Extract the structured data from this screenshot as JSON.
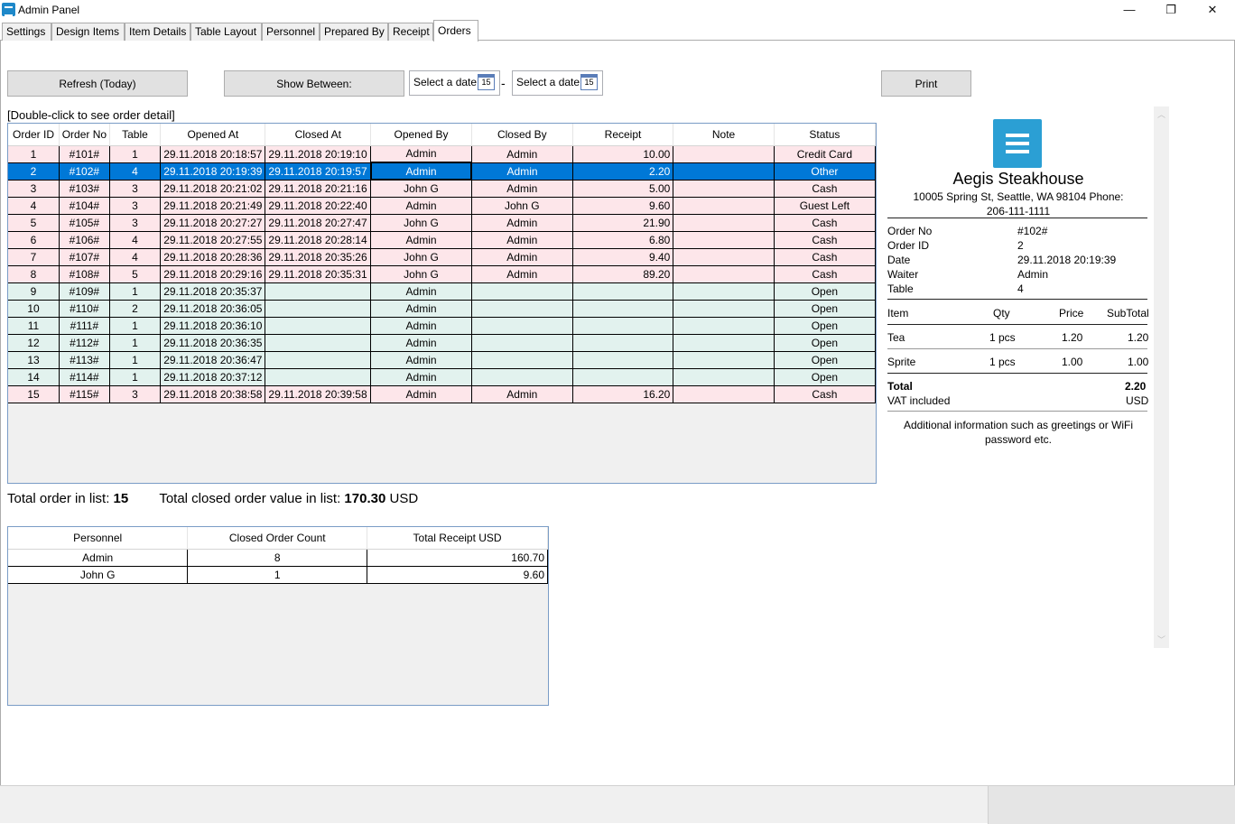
{
  "window": {
    "title": "Admin Panel",
    "minimize": "—",
    "restore": "❐",
    "close": "✕"
  },
  "tabs": [
    "Settings",
    "Design Items",
    "Item Details",
    "Table Layout",
    "Personnel",
    "Prepared By",
    "Receipt",
    "Orders"
  ],
  "active_tab": "Orders",
  "toolbar": {
    "refresh_label": "Refresh (Today)",
    "show_between_label": "Show Between:",
    "date_from_placeholder": "Select a date",
    "date_to_placeholder": "Select a date",
    "calendar_day": "15",
    "dash": "-",
    "print_label": "Print"
  },
  "hint": "[Double-click to see order detail]",
  "orders": {
    "columns": [
      "Order ID",
      "Order No",
      "Table",
      "Opened At",
      "Closed At",
      "Opened By",
      "Closed By",
      "Receipt",
      "Note",
      "Status"
    ],
    "selected_index": 1,
    "rows": [
      {
        "id": "1",
        "no": "#101#",
        "table": "1",
        "opened_at": "29.11.2018 20:18:57",
        "closed_at": "29.11.2018 20:19:10",
        "opened_by": "Admin",
        "closed_by": "Admin",
        "receipt": "10.00",
        "note": "",
        "status": "Credit Card"
      },
      {
        "id": "2",
        "no": "#102#",
        "table": "4",
        "opened_at": "29.11.2018 20:19:39",
        "closed_at": "29.11.2018 20:19:57",
        "opened_by": "Admin",
        "closed_by": "Admin",
        "receipt": "2.20",
        "note": "",
        "status": "Other"
      },
      {
        "id": "3",
        "no": "#103#",
        "table": "3",
        "opened_at": "29.11.2018 20:21:02",
        "closed_at": "29.11.2018 20:21:16",
        "opened_by": "John G",
        "closed_by": "Admin",
        "receipt": "5.00",
        "note": "",
        "status": "Cash"
      },
      {
        "id": "4",
        "no": "#104#",
        "table": "3",
        "opened_at": "29.11.2018 20:21:49",
        "closed_at": "29.11.2018 20:22:40",
        "opened_by": "Admin",
        "closed_by": "John G",
        "receipt": "9.60",
        "note": "",
        "status": "Guest Left"
      },
      {
        "id": "5",
        "no": "#105#",
        "table": "3",
        "opened_at": "29.11.2018 20:27:27",
        "closed_at": "29.11.2018 20:27:47",
        "opened_by": "John G",
        "closed_by": "Admin",
        "receipt": "21.90",
        "note": "",
        "status": "Cash"
      },
      {
        "id": "6",
        "no": "#106#",
        "table": "4",
        "opened_at": "29.11.2018 20:27:55",
        "closed_at": "29.11.2018 20:28:14",
        "opened_by": "Admin",
        "closed_by": "Admin",
        "receipt": "6.80",
        "note": "",
        "status": "Cash"
      },
      {
        "id": "7",
        "no": "#107#",
        "table": "4",
        "opened_at": "29.11.2018 20:28:36",
        "closed_at": "29.11.2018 20:35:26",
        "opened_by": "John G",
        "closed_by": "Admin",
        "receipt": "9.40",
        "note": "",
        "status": "Cash"
      },
      {
        "id": "8",
        "no": "#108#",
        "table": "5",
        "opened_at": "29.11.2018 20:29:16",
        "closed_at": "29.11.2018 20:35:31",
        "opened_by": "John G",
        "closed_by": "Admin",
        "receipt": "89.20",
        "note": "",
        "status": "Cash"
      },
      {
        "id": "9",
        "no": "#109#",
        "table": "1",
        "opened_at": "29.11.2018 20:35:37",
        "closed_at": "",
        "opened_by": "Admin",
        "closed_by": "",
        "receipt": "",
        "note": "",
        "status": "Open"
      },
      {
        "id": "10",
        "no": "#110#",
        "table": "2",
        "opened_at": "29.11.2018 20:36:05",
        "closed_at": "",
        "opened_by": "Admin",
        "closed_by": "",
        "receipt": "",
        "note": "",
        "status": "Open"
      },
      {
        "id": "11",
        "no": "#111#",
        "table": "1",
        "opened_at": "29.11.2018 20:36:10",
        "closed_at": "",
        "opened_by": "Admin",
        "closed_by": "",
        "receipt": "",
        "note": "",
        "status": "Open"
      },
      {
        "id": "12",
        "no": "#112#",
        "table": "1",
        "opened_at": "29.11.2018 20:36:35",
        "closed_at": "",
        "opened_by": "Admin",
        "closed_by": "",
        "receipt": "",
        "note": "",
        "status": "Open"
      },
      {
        "id": "13",
        "no": "#113#",
        "table": "1",
        "opened_at": "29.11.2018 20:36:47",
        "closed_at": "",
        "opened_by": "Admin",
        "closed_by": "",
        "receipt": "",
        "note": "",
        "status": "Open"
      },
      {
        "id": "14",
        "no": "#114#",
        "table": "1",
        "opened_at": "29.11.2018 20:37:12",
        "closed_at": "",
        "opened_by": "Admin",
        "closed_by": "",
        "receipt": "",
        "note": "",
        "status": "Open"
      },
      {
        "id": "15",
        "no": "#115#",
        "table": "3",
        "opened_at": "29.11.2018 20:38:58",
        "closed_at": "29.11.2018 20:39:58",
        "opened_by": "Admin",
        "closed_by": "Admin",
        "receipt": "16.20",
        "note": "",
        "status": "Cash"
      }
    ]
  },
  "totals": {
    "order_label": "Total order in list: ",
    "order_count": "15",
    "value_label": "Total closed order value in list: ",
    "value": "170.30",
    "currency": " USD"
  },
  "personnel": {
    "columns": [
      "Personnel",
      "Closed Order Count",
      "Total Receipt USD"
    ],
    "rows": [
      {
        "name": "Admin",
        "count": "8",
        "total": "160.70"
      },
      {
        "name": "John G",
        "count": "1",
        "total": "9.60"
      }
    ]
  },
  "receipt": {
    "restaurant": "Aegis Steakhouse",
    "address_line1": "10005 Spring St, Seattle, WA 98104 Phone:",
    "address_line2": "206-111-1111",
    "order_no_label": "Order No",
    "order_no": "#102#",
    "order_id_label": "Order ID",
    "order_id": "2",
    "date_label": "Date",
    "date": "29.11.2018 20:19:39",
    "waiter_label": "Waiter",
    "waiter": "Admin",
    "table_label": "Table",
    "table": "4",
    "item_header": "Item",
    "qty_header": "Qty",
    "price_header": "Price",
    "subtotal_header": "SubTotal",
    "items": [
      {
        "name": "Tea",
        "qty": "1 pcs",
        "price": "1.20",
        "subtotal": "1.20"
      },
      {
        "name": "Sprite",
        "qty": "1 pcs",
        "price": "1.00",
        "subtotal": "1.00"
      }
    ],
    "total_label": "Total",
    "total": "2.20",
    "vat_label": "VAT included",
    "currency": "USD",
    "footer_line1": "Additional information such as greetings or WiFi",
    "footer_line2": "password etc."
  },
  "colors": {
    "selected": "#0078d7",
    "closed_row": "#fde6ea",
    "open_row": "#e2f2ee",
    "logo": "#2b9fd4"
  }
}
